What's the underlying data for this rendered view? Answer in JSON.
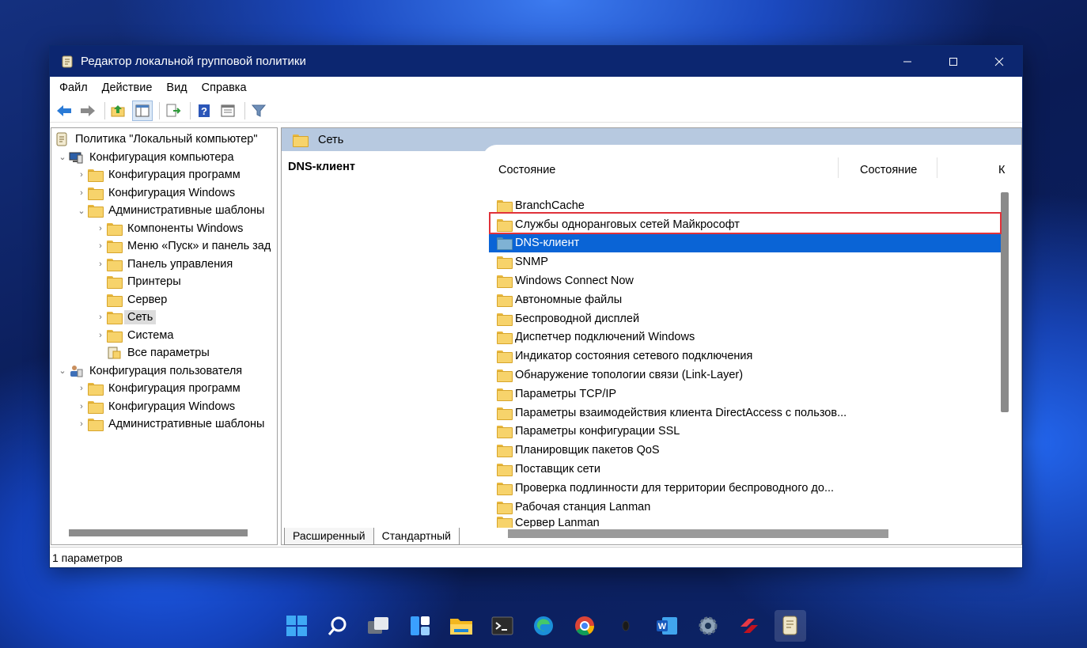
{
  "window": {
    "title": "Редактор локальной групповой политики",
    "controls": {
      "minimize": "—",
      "maximize": "☐",
      "close": "✕"
    }
  },
  "menu": [
    "Файл",
    "Действие",
    "Вид",
    "Справка"
  ],
  "toolbar_icons": [
    "back-arrow-icon",
    "forward-arrow-icon",
    "folder-up-icon",
    "show-hide-tree-icon",
    "export-list-icon",
    "help-icon",
    "properties-icon",
    "filter-icon"
  ],
  "tree": {
    "root": "Политика \"Локальный компьютер\"",
    "computer_config": "Конфигурация компьютера",
    "cc_software": "Конфигурация программ",
    "cc_windows": "Конфигурация Windows",
    "cc_admin_templates": "Административные шаблоны",
    "at_windows_components": "Компоненты Windows",
    "at_start_menu": "Меню «Пуск» и панель зад",
    "at_control_panel": "Панель управления",
    "at_printers": "Принтеры",
    "at_server": "Сервер",
    "at_network": "Сеть",
    "at_system": "Система",
    "at_all_settings": "Все параметры",
    "user_config": "Конфигурация пользователя",
    "uc_software": "Конфигурация программ",
    "uc_windows": "Конфигурация Windows",
    "uc_admin_templates": "Административные шаблоны"
  },
  "right": {
    "header": "Сеть",
    "detail_title": "DNS-клиент",
    "columns": [
      "Состояние",
      "Состояние",
      "К"
    ],
    "items": [
      "BranchCache",
      "Службы одноранговых сетей Майкрософт",
      "DNS-клиент",
      "SNMP",
      "Windows Connect Now",
      "Автономные файлы",
      "Беспроводной дисплей",
      "Диспетчер подключений Windows",
      "Индикатор состояния сетевого подключения",
      "Обнаружение топологии связи (Link-Layer)",
      "Параметры TCP/IP",
      "Параметры взаимодействия клиента DirectAccess с пользов...",
      "Параметры конфигурации SSL",
      "Планировщик пакетов QoS",
      "Поставщик сети",
      "Проверка подлинности для территории беспроводного до...",
      "Рабочая станция Lanman",
      "Сервер Lanman"
    ],
    "selected_item": "DNS-клиент"
  },
  "tabs": [
    "Расширенный",
    "Стандартный"
  ],
  "status": "1 параметров",
  "taskbar_icons": [
    "windows-start-icon",
    "search-icon",
    "task-view-icon",
    "widgets-icon",
    "file-explorer-icon",
    "terminal-icon",
    "edge-icon",
    "chrome-icon",
    "app-icon",
    "word-icon",
    "settings-icon",
    "app-red-icon",
    "policy-editor-icon"
  ]
}
